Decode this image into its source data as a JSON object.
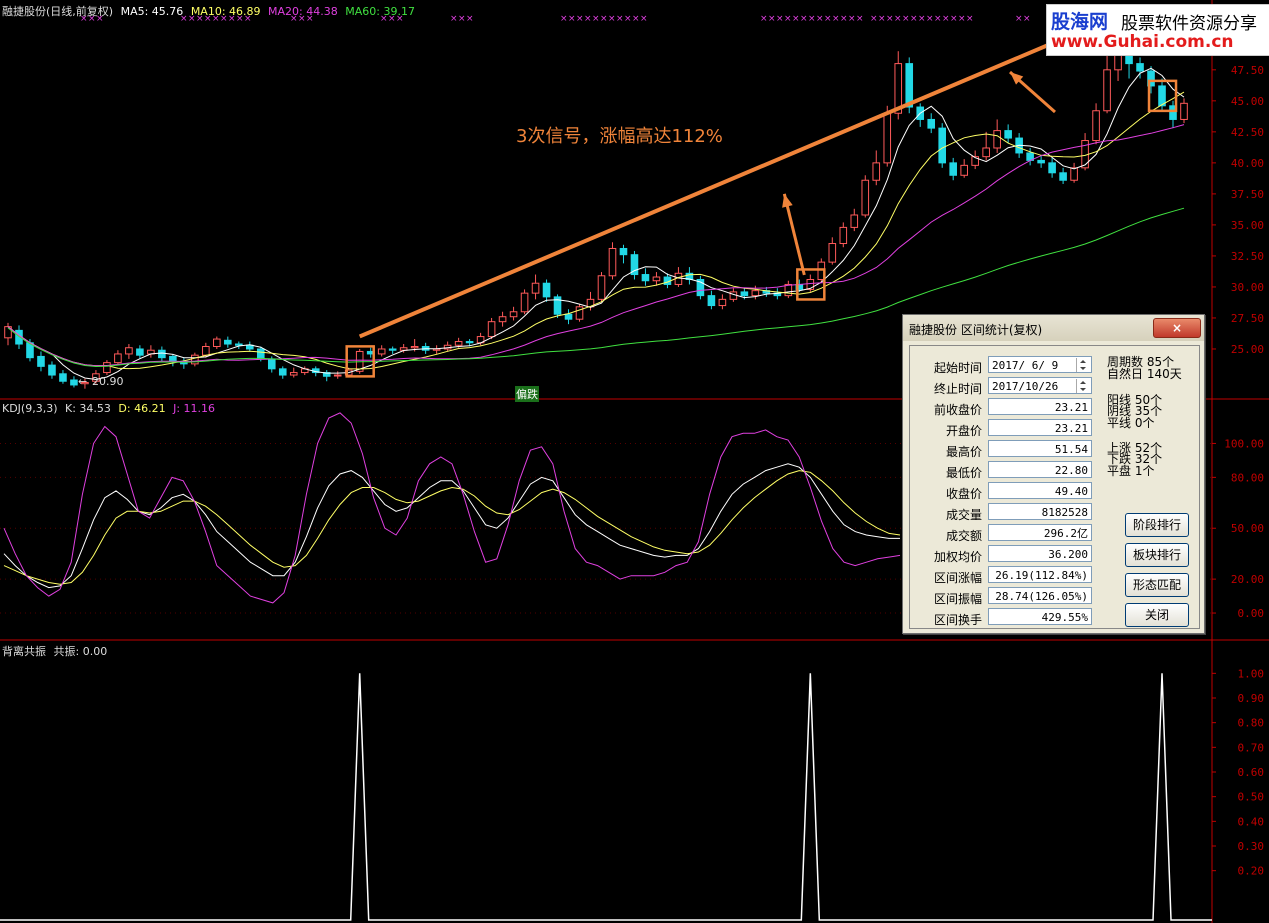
{
  "main_header": {
    "stock": "融捷股份(日线,前复权)",
    "ma5": "MA5: 45.76",
    "ma10": "MA10: 46.89",
    "ma20": "MA20: 44.38",
    "ma60": "MA60: 39.17"
  },
  "colors": {
    "bg": "#000000",
    "up_candle": "#ff5a5a",
    "down_candle": "#22d8e6",
    "ma5": "#ffffff",
    "ma10": "#ffff66",
    "ma20": "#e040e0",
    "ma60": "#40e040",
    "annotation": "#f0843a",
    "axis": "#c00000",
    "signal_marks": "#e040e0"
  },
  "watermark": {
    "brand": "股海网",
    "tagline": "股票软件资源分享",
    "url": "www.Guhai.com.cn"
  },
  "annotation": {
    "text": "3次信号，涨幅高达112%",
    "low_label": "20.90",
    "tag": "偏跌"
  },
  "kdj_header": {
    "name": "KDJ(9,3,3)",
    "k": "K: 34.53",
    "d": "D: 46.21",
    "j": "J: 11.16"
  },
  "signal_header": {
    "name": "背离共振",
    "value": "共振: 0.00"
  },
  "dialog": {
    "title": "融捷股份 区间统计(复权)",
    "close": "×",
    "fields": [
      {
        "label": "起始时间",
        "value": "2017/ 6/ 9"
      },
      {
        "label": "终止时间",
        "value": "2017/10/26"
      },
      {
        "label": "前收盘价",
        "value": "23.21"
      },
      {
        "label": "开盘价",
        "value": "23.21"
      },
      {
        "label": "最高价",
        "value": "51.54"
      },
      {
        "label": "最低价",
        "value": "22.80"
      },
      {
        "label": "收盘价",
        "value": "49.40"
      },
      {
        "label": "成交量",
        "value": "8182528"
      },
      {
        "label": "成交额",
        "value": "296.2亿"
      },
      {
        "label": "加权均价",
        "value": "36.200"
      },
      {
        "label": "区间涨幅",
        "value": "26.19(112.84%)"
      },
      {
        "label": "区间振幅",
        "value": "28.74(126.05%)"
      },
      {
        "label": "区间换手",
        "value": "429.55%"
      }
    ],
    "stats": {
      "period": "周期数 85个",
      "natural": "自然日 140天",
      "yang": "阳线 50个",
      "yin": "阴线 35个",
      "flat": "平线 0个",
      "up": "上涨 52个",
      "down": "下跌 32个",
      "even": "平盘 1个"
    },
    "buttons": [
      "阶段排行",
      "板块排行",
      "形态匹配",
      "关闭"
    ]
  },
  "chart_data": [
    {
      "type": "candlestick",
      "title": "融捷股份(日线,前复权)",
      "ylim": [
        22.5,
        49.5
      ],
      "y_ticks": [
        "25.00",
        "27.50",
        "30.00",
        "32.50",
        "35.00",
        "37.50",
        "40.00",
        "42.50",
        "45.00",
        "47.50"
      ],
      "candles": [
        [
          25.9,
          26.8,
          25.3,
          27.1
        ],
        [
          26.5,
          25.4,
          25.0,
          26.9
        ],
        [
          25.5,
          24.3,
          24.0,
          25.8
        ],
        [
          24.4,
          23.6,
          23.2,
          24.8
        ],
        [
          23.7,
          22.9,
          22.6,
          24.0
        ],
        [
          23.0,
          22.4,
          22.2,
          23.3
        ],
        [
          22.5,
          22.1,
          21.9,
          22.8
        ],
        [
          22.2,
          22.3,
          21.8,
          22.6
        ],
        [
          22.4,
          23.0,
          22.2,
          23.3
        ],
        [
          23.1,
          23.9,
          22.9,
          24.1
        ],
        [
          23.9,
          24.6,
          23.7,
          24.9
        ],
        [
          24.6,
          25.1,
          24.2,
          25.4
        ],
        [
          25.0,
          24.5,
          24.2,
          25.3
        ],
        [
          24.6,
          24.9,
          24.3,
          25.3
        ],
        [
          24.9,
          24.3,
          24.0,
          25.2
        ],
        [
          24.4,
          24.0,
          23.6,
          24.6
        ],
        [
          24.0,
          23.8,
          23.4,
          24.3
        ],
        [
          23.8,
          24.5,
          23.6,
          24.7
        ],
        [
          24.5,
          25.2,
          24.3,
          25.5
        ],
        [
          25.2,
          25.8,
          25.0,
          26.0
        ],
        [
          25.7,
          25.4,
          25.1,
          26.0
        ],
        [
          25.4,
          25.3,
          25.0,
          25.6
        ],
        [
          25.3,
          25.0,
          24.8,
          25.6
        ],
        [
          25.0,
          24.2,
          24.0,
          25.2
        ],
        [
          24.2,
          23.4,
          23.1,
          24.4
        ],
        [
          23.4,
          22.9,
          22.6,
          23.6
        ],
        [
          22.9,
          23.1,
          22.7,
          23.5
        ],
        [
          23.1,
          23.4,
          22.9,
          23.6
        ],
        [
          23.4,
          23.1,
          22.8,
          23.6
        ],
        [
          23.1,
          22.8,
          22.4,
          23.3
        ],
        [
          22.9,
          22.9,
          22.6,
          23.2
        ],
        [
          22.9,
          23.3,
          22.7,
          23.5
        ],
        [
          23.2,
          24.8,
          23.0,
          25.0
        ],
        [
          24.8,
          24.6,
          24.3,
          25.1
        ],
        [
          24.6,
          25.0,
          24.4,
          25.3
        ],
        [
          25.0,
          24.9,
          24.6,
          25.2
        ],
        [
          24.9,
          25.1,
          24.7,
          25.4
        ],
        [
          25.1,
          25.2,
          24.8,
          25.8
        ],
        [
          25.2,
          24.9,
          24.6,
          25.5
        ],
        [
          24.9,
          25.0,
          24.6,
          25.3
        ],
        [
          25.0,
          25.3,
          24.8,
          25.6
        ],
        [
          25.3,
          25.6,
          25.1,
          25.9
        ],
        [
          25.6,
          25.5,
          25.2,
          25.8
        ],
        [
          25.5,
          26.0,
          25.3,
          26.3
        ],
        [
          26.0,
          27.2,
          25.8,
          27.5
        ],
        [
          27.2,
          27.6,
          26.8,
          28.0
        ],
        [
          27.6,
          28.0,
          27.3,
          28.4
        ],
        [
          28.0,
          29.5,
          27.8,
          29.8
        ],
        [
          29.5,
          30.3,
          29.0,
          31.0
        ],
        [
          30.3,
          29.2,
          28.8,
          30.6
        ],
        [
          29.2,
          27.8,
          27.5,
          29.4
        ],
        [
          27.8,
          27.4,
          27.0,
          28.2
        ],
        [
          27.4,
          28.4,
          27.2,
          28.6
        ],
        [
          28.4,
          29.0,
          28.1,
          29.6
        ],
        [
          29.0,
          30.9,
          28.8,
          31.2
        ],
        [
          30.9,
          33.1,
          30.6,
          33.6
        ],
        [
          33.1,
          32.6,
          31.9,
          33.4
        ],
        [
          32.6,
          31.0,
          30.6,
          32.9
        ],
        [
          31.0,
          30.5,
          30.1,
          31.5
        ],
        [
          30.5,
          30.8,
          30.1,
          31.2
        ],
        [
          30.8,
          30.2,
          29.9,
          31.1
        ],
        [
          30.2,
          31.1,
          30.0,
          31.6
        ],
        [
          31.1,
          30.6,
          30.2,
          31.6
        ],
        [
          30.6,
          29.3,
          29.0,
          30.9
        ],
        [
          29.3,
          28.5,
          28.2,
          29.7
        ],
        [
          28.5,
          29.0,
          28.2,
          29.4
        ],
        [
          29.0,
          29.6,
          28.8,
          29.9
        ],
        [
          29.6,
          29.3,
          29.0,
          29.9
        ],
        [
          29.3,
          29.7,
          29.0,
          30.1
        ],
        [
          29.7,
          29.5,
          29.2,
          30.0
        ],
        [
          29.5,
          29.3,
          29.0,
          29.9
        ],
        [
          29.3,
          30.2,
          29.1,
          30.5
        ],
        [
          30.2,
          29.8,
          29.6,
          30.6
        ],
        [
          29.8,
          30.6,
          29.6,
          31.0
        ],
        [
          30.6,
          32.0,
          30.4,
          32.3
        ],
        [
          32.0,
          33.5,
          31.8,
          34.0
        ],
        [
          33.5,
          34.8,
          33.2,
          35.2
        ],
        [
          34.8,
          35.8,
          34.5,
          36.3
        ],
        [
          35.8,
          38.6,
          35.6,
          39.0
        ],
        [
          38.6,
          40.0,
          38.2,
          41.0
        ],
        [
          40.0,
          44.0,
          39.7,
          44.6
        ],
        [
          44.0,
          48.0,
          43.5,
          49.0
        ],
        [
          48.0,
          44.5,
          44.0,
          48.5
        ],
        [
          44.5,
          43.5,
          42.9,
          44.8
        ],
        [
          43.5,
          42.8,
          42.4,
          44.0
        ],
        [
          42.8,
          40.0,
          39.6,
          43.2
        ],
        [
          40.0,
          39.0,
          38.6,
          40.4
        ],
        [
          39.0,
          39.8,
          38.8,
          40.3
        ],
        [
          39.8,
          40.5,
          39.5,
          41.0
        ],
        [
          40.5,
          41.2,
          40.2,
          42.5
        ],
        [
          41.2,
          42.6,
          40.8,
          43.5
        ],
        [
          42.6,
          42.0,
          41.6,
          43.1
        ],
        [
          42.0,
          40.8,
          40.4,
          42.4
        ],
        [
          40.8,
          40.2,
          39.8,
          41.2
        ],
        [
          40.2,
          40.0,
          39.6,
          40.6
        ],
        [
          40.0,
          39.2,
          38.8,
          40.4
        ],
        [
          39.2,
          38.6,
          38.3,
          39.6
        ],
        [
          38.6,
          39.6,
          38.4,
          40.0
        ],
        [
          39.6,
          41.8,
          39.4,
          42.4
        ],
        [
          41.8,
          44.2,
          41.5,
          44.8
        ],
        [
          44.2,
          47.5,
          44.0,
          49.0
        ],
        [
          47.5,
          49.0,
          46.6,
          49.5
        ],
        [
          49.0,
          48.0,
          46.8,
          49.5
        ],
        [
          48.0,
          47.4,
          46.8,
          48.5
        ],
        [
          47.4,
          46.2,
          45.6,
          47.8
        ],
        [
          46.2,
          44.6,
          44.2,
          46.8
        ],
        [
          44.6,
          43.5,
          42.8,
          45.0
        ],
        [
          43.5,
          44.8,
          43.2,
          45.2
        ]
      ]
    },
    {
      "type": "line",
      "title": "KDJ(9,3,3)",
      "ylim": [
        -10,
        115
      ],
      "y_ticks": [
        "100.00",
        "80.00",
        "50.00",
        "20.00",
        "0.00"
      ],
      "series": [
        {
          "name": "K",
          "values": [
            35,
            28,
            22,
            18,
            15,
            16,
            22,
            38,
            55,
            68,
            72,
            67,
            60,
            58,
            62,
            68,
            70,
            66,
            58,
            48,
            42,
            36,
            30,
            26,
            22,
            22,
            30,
            45,
            62,
            75,
            82,
            84,
            80,
            72,
            64,
            60,
            62,
            68,
            74,
            78,
            78,
            72,
            62,
            52,
            50,
            56,
            66,
            76,
            80,
            78,
            68,
            58,
            52,
            48,
            44,
            40,
            38,
            36,
            34,
            33,
            34,
            34,
            38,
            48,
            60,
            70,
            76,
            80,
            84,
            86,
            88,
            86,
            80,
            70,
            60,
            52,
            48,
            46,
            45,
            44,
            44
          ]
        },
        {
          "name": "D",
          "values": [
            28,
            25,
            22,
            20,
            18,
            17,
            18,
            24,
            34,
            46,
            56,
            60,
            60,
            59,
            60,
            63,
            66,
            66,
            63,
            58,
            52,
            46,
            40,
            35,
            30,
            27,
            28,
            34,
            44,
            55,
            64,
            71,
            74,
            74,
            71,
            67,
            65,
            66,
            69,
            72,
            74,
            73,
            69,
            63,
            59,
            58,
            61,
            66,
            71,
            73,
            71,
            67,
            62,
            57,
            53,
            49,
            45,
            42,
            39,
            37,
            36,
            35,
            36,
            40,
            47,
            55,
            62,
            68,
            73,
            78,
            82,
            84,
            83,
            78,
            72,
            65,
            59,
            54,
            50,
            47,
            46
          ]
        },
        {
          "name": "J",
          "values": [
            50,
            35,
            22,
            15,
            10,
            14,
            30,
            70,
            100,
            110,
            104,
            82,
            60,
            56,
            68,
            80,
            78,
            66,
            48,
            28,
            22,
            16,
            10,
            8,
            6,
            12,
            34,
            70,
            100,
            115,
            118,
            112,
            94,
            68,
            50,
            46,
            56,
            78,
            88,
            92,
            88,
            70,
            48,
            30,
            32,
            52,
            78,
            96,
            98,
            88,
            60,
            38,
            30,
            28,
            24,
            20,
            22,
            22,
            22,
            24,
            28,
            30,
            42,
            70,
            92,
            104,
            106,
            106,
            108,
            104,
            102,
            92,
            74,
            54,
            38,
            30,
            28,
            30,
            32,
            33,
            34
          ]
        }
      ]
    },
    {
      "type": "line",
      "title": "背离共振",
      "ylim": [
        0,
        1.05
      ],
      "y_ticks": [
        "1.00",
        "0.90",
        "0.80",
        "0.70",
        "0.60",
        "0.50",
        "0.40",
        "0.30",
        "0.20"
      ],
      "series": [
        {
          "name": "共振",
          "spikes_at_bar": [
            32,
            73,
            105
          ],
          "values": [
            0,
            1,
            0
          ]
        }
      ]
    }
  ]
}
